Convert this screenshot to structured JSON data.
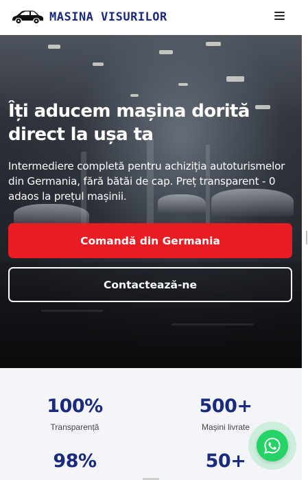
{
  "header": {
    "brand": "MASINA VISURILOR",
    "logo_icon": "car-logo-icon",
    "menu_icon": "hamburger-menu-icon"
  },
  "hero": {
    "title": "Îți aducem mașina dorită direct la ușa ta",
    "subtitle": "Intermediere completă pentru achiziția autoturismelor din Germania, fără bătăi de cap. Preț transparent - 0 adaos la prețul mașinii.",
    "primary_button": "Comandă din Germania",
    "secondary_button": "Contactează-ne"
  },
  "stats": [
    {
      "value": "100%",
      "label": "Transparență"
    },
    {
      "value": "500+",
      "label": "Mașini livrate"
    },
    {
      "value": "98%",
      "label": ""
    },
    {
      "value": "50+",
      "label": ""
    }
  ],
  "colors": {
    "brand_blue": "#1a2a7c",
    "primary_red": "#e81c23",
    "whatsapp_green": "#25d366",
    "stats_bg": "#f3f5f8"
  },
  "floating": {
    "whatsapp_icon": "whatsapp-icon"
  }
}
